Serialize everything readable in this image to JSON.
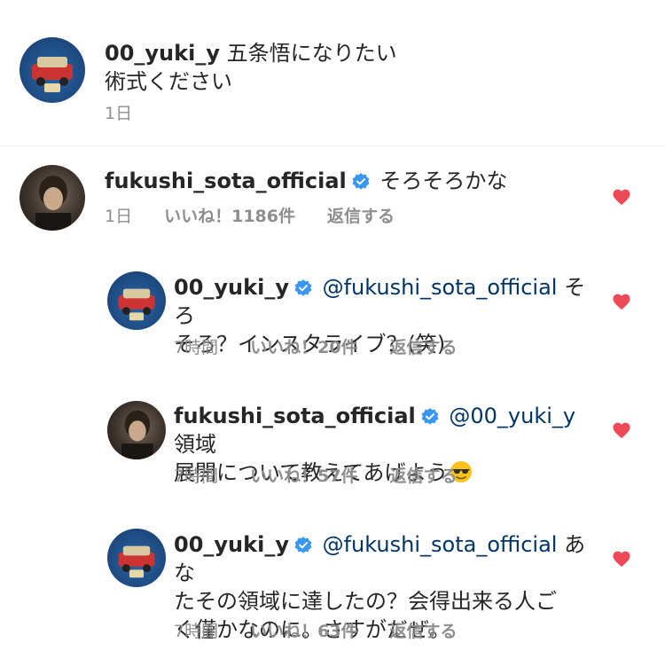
{
  "comments": [
    {
      "username": "00_yuki_y",
      "text_line1": "五条悟になりたい",
      "text_line2": "術式ください",
      "time": "1日"
    },
    {
      "username": "fukushi_sota_official",
      "text": "そろそろかな",
      "time": "1日",
      "likes": "いいね！1186件",
      "reply": "返信する"
    }
  ],
  "replies": [
    {
      "username": "00_yuki_y",
      "mention": "@fukushi_sota_official",
      "text_line1_suffix": "そろ",
      "text_line2": "そろ？インスタライブ？(笑)",
      "time": "7時間",
      "likes": "いいね！20件",
      "reply": "返信する"
    },
    {
      "username": "fukushi_sota_official",
      "mention": "@00_yuki_y",
      "text_line1_suffix": "領域",
      "text_line2": "展開について教えてあげよう",
      "time": "7時間",
      "likes": "いいね！57件",
      "reply": "返信する"
    },
    {
      "username": "00_yuki_y",
      "mention": "@fukushi_sota_official",
      "text_line1_suffix": "あな",
      "text_line2": "たその領域に達したの？会得出来る人ご",
      "text_line3": "く僅かなのに。さすがだぜ。",
      "time": "7時間",
      "likes": "いいね！63件",
      "reply": "返信する"
    }
  ],
  "colors": {
    "heart": "#ed4956",
    "verified": "#3897f0",
    "mention": "#003569",
    "meta": "#8e8e8e"
  }
}
